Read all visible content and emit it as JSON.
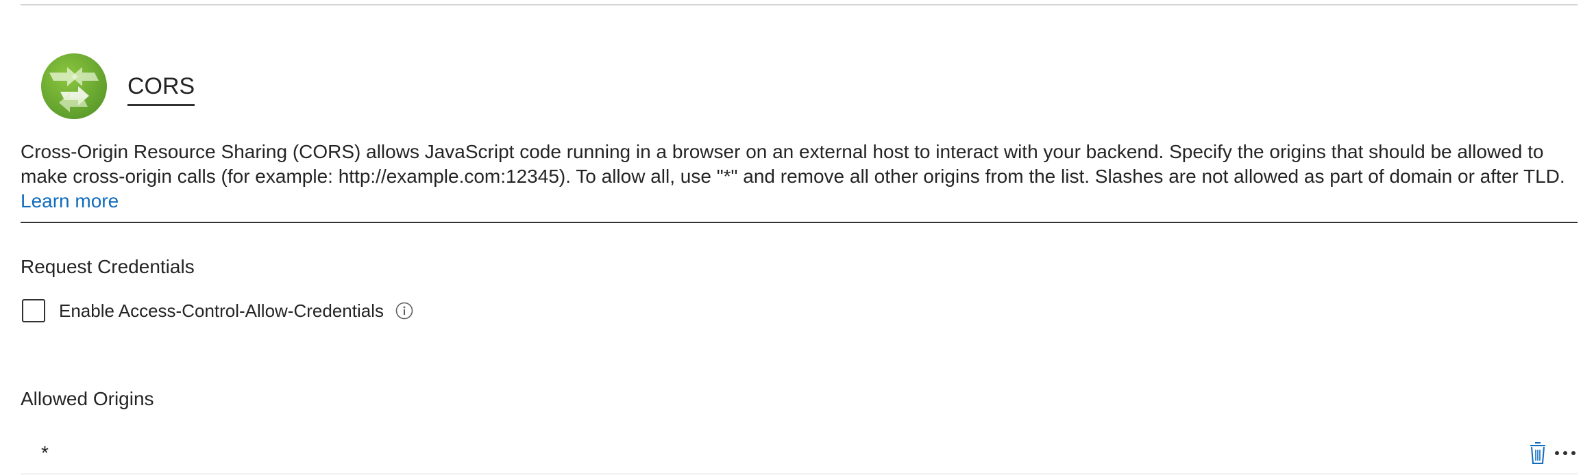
{
  "section": {
    "title": "CORS",
    "logo_icon": "cors-arrows-icon",
    "logo_color": "#6aab34"
  },
  "description": {
    "text": "Cross-Origin Resource Sharing (CORS) allows JavaScript code running in a browser on an external host to interact with your backend. Specify the origins that should be allowed to make cross-origin calls (for example: http://example.com:12345). To allow all, use \"*\" and remove all other origins from the list. Slashes are not allowed as part of domain or after TLD.",
    "learn_more": "Learn more",
    "link_color": "#0f6cbd"
  },
  "credentials": {
    "section_label": "Request Credentials",
    "checkbox_label": "Enable Access-Control-Allow-Credentials",
    "checked": false,
    "info_icon": "info-icon"
  },
  "origins": {
    "section_label": "Allowed Origins",
    "items": [
      {
        "value": "*",
        "delete_icon": "trash-icon",
        "more_icon": "ellipsis-icon"
      }
    ]
  }
}
